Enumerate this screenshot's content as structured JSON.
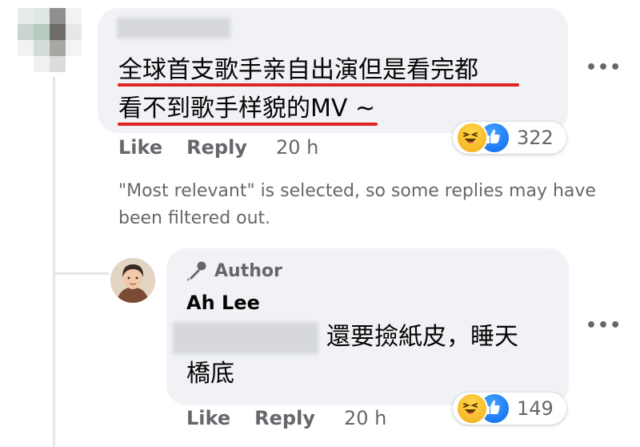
{
  "comment": {
    "text_line1": "全球首支歌手亲自出演但是看完都",
    "text_line2": "看不到歌手样貌的MV ~",
    "reaction_count": "322",
    "like_label": "Like",
    "reply_label": "Reply",
    "time": "20 h",
    "more_label": "•••"
  },
  "filter_note": "\"Most relevant\" is selected, so some replies may have been filtered out.",
  "reply": {
    "badge_label": "Author",
    "author_name": "Ah Lee",
    "text_line1": "還要撿紙皮，睡天",
    "text_line2": "橋底",
    "reaction_count": "149",
    "like_label": "Like",
    "reply_label": "Reply",
    "time": "20 h",
    "more_label": "•••"
  },
  "icons": {
    "reactions": [
      "haha-icon",
      "like-icon"
    ],
    "badge": "microphone-icon",
    "more": "more-options-icon"
  },
  "colors": {
    "bubble": "#f0f2f5",
    "secondary_text": "#65676b",
    "underline": "#e02424",
    "like_blue": "#1877f2",
    "haha_yellow": "#f7b928"
  }
}
